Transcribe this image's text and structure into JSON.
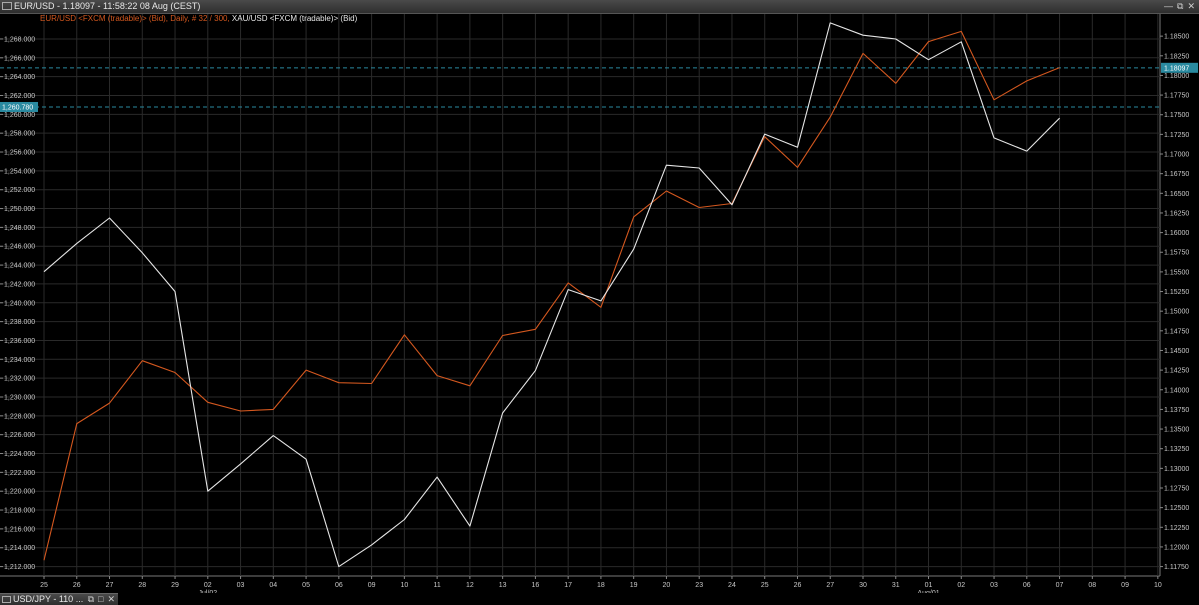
{
  "window": {
    "title": "EUR/USD - 1.18097 - 11:58:22  08 Aug (CEST)",
    "buttons": [
      "—",
      "⧉",
      "✕"
    ]
  },
  "legend": {
    "series1": "EUR/USD <FXCM (tradable)> (Bid), Daily, # 32 / 300, ",
    "series2": "XAU/USD <FXCM (tradable)> (Bid)"
  },
  "bottom_window": {
    "title": "USD/JPY - 110 ...",
    "buttons": [
      "⧉",
      "□",
      "✕"
    ]
  },
  "colors": {
    "eurusd": "#d4581f",
    "xauusd": "#e6e6e6",
    "guide": "#2a8aa0",
    "badge": "#2a8aa0",
    "grid": "#2a2a2a"
  },
  "chart_data": {
    "type": "line",
    "x": [
      "25",
      "26",
      "27",
      "28",
      "29",
      "02",
      "03",
      "04",
      "05",
      "06",
      "09",
      "10",
      "11",
      "12",
      "13",
      "16",
      "17",
      "18",
      "19",
      "20",
      "23",
      "24",
      "25",
      "26",
      "27",
      "30",
      "31",
      "01",
      "02",
      "03",
      "06",
      "07",
      "08",
      "09",
      "10"
    ],
    "month_labels": [
      {
        "index": 5,
        "label": "Jul/02"
      },
      {
        "index": 27,
        "label": "Aug/01"
      }
    ],
    "left_axis": {
      "ticks": [
        "1,212.000",
        "1,214.000",
        "1,216.000",
        "1,218.000",
        "1,220.000",
        "1,222.000",
        "1,224.000",
        "1,226.000",
        "1,228.000",
        "1,230.000",
        "1,232.000",
        "1,234.000",
        "1,236.000",
        "1,238.000",
        "1,240.000",
        "1,242.000",
        "1,244.000",
        "1,246.000",
        "1,248.000",
        "1,250.000",
        "1,252.000",
        "1,254.000",
        "1,256.000",
        "1,258.000",
        "1,260.000",
        "1,262.000",
        "1,264.000",
        "1,266.000",
        "1,268.000"
      ],
      "range": [
        1211.0,
        1269.8
      ]
    },
    "right_axis": {
      "ticks": [
        "1.11750",
        "1.12000",
        "1.12250",
        "1.12500",
        "1.12750",
        "1.13000",
        "1.13250",
        "1.13500",
        "1.13750",
        "1.14000",
        "1.14250",
        "1.14500",
        "1.14750",
        "1.15000",
        "1.15250",
        "1.15500",
        "1.15750",
        "1.16000",
        "1.16250",
        "1.16500",
        "1.16750",
        "1.17000",
        "1.17250",
        "1.17500",
        "1.17750",
        "1.18000",
        "1.18250",
        "1.18500"
      ],
      "range": [
        1.1163,
        1.1868
      ]
    },
    "series": [
      {
        "name": "EUR/USD",
        "axis": "right",
        "values": [
          1.1183,
          1.1357,
          1.1383,
          1.1437,
          1.1422,
          1.1384,
          1.1373,
          1.1375,
          1.1425,
          1.1409,
          1.1408,
          1.147,
          1.1418,
          1.1405,
          1.1469,
          1.1477,
          1.1536,
          1.1505,
          1.162,
          1.1653,
          1.1632,
          1.1637,
          1.1722,
          1.1683,
          1.1747,
          1.1828,
          1.179,
          1.1843,
          1.1856,
          1.1769,
          1.1793,
          1.181
        ]
      },
      {
        "name": "XAU/USD",
        "axis": "left",
        "values": [
          1243.3,
          1246.3,
          1249.0,
          1245.3,
          1241.2,
          1220.0,
          1222.9,
          1225.9,
          1223.4,
          1212.0,
          1214.3,
          1217.0,
          1221.5,
          1216.3,
          1228.3,
          1232.8,
          1241.4,
          1240.2,
          1245.7,
          1254.6,
          1254.3,
          1250.4,
          1257.9,
          1256.5,
          1269.7,
          1268.4,
          1268.0,
          1265.8,
          1267.7,
          1257.5,
          1256.1,
          1259.6
        ]
      }
    ],
    "current_price_right": "1.18097",
    "current_price_left": "1,260.780"
  }
}
